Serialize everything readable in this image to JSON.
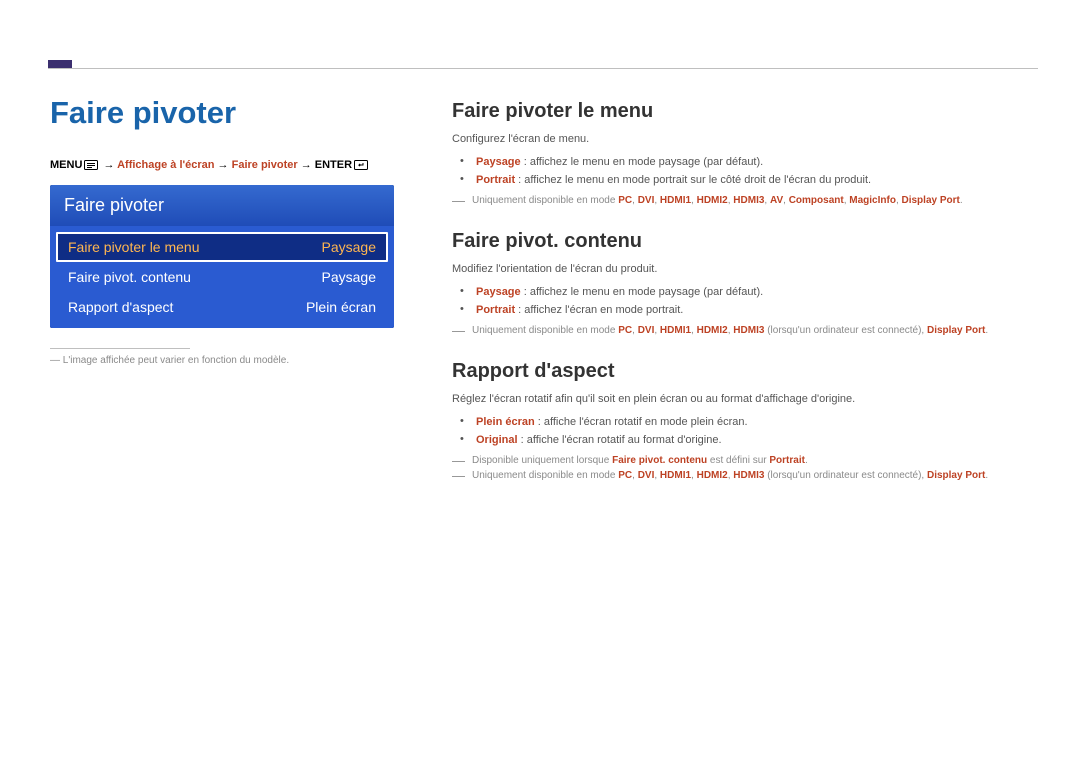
{
  "main_title": "Faire pivoter",
  "breadcrumb": {
    "menu": "MENU",
    "arrow": "→",
    "p1": "Affichage à l'écran",
    "p2": "Faire pivoter",
    "enter": "ENTER"
  },
  "osd": {
    "title": "Faire pivoter",
    "rows": [
      {
        "label": "Faire pivoter le menu",
        "value": "Paysage",
        "selected": true
      },
      {
        "label": "Faire pivot. contenu",
        "value": "Paysage",
        "selected": false
      },
      {
        "label": "Rapport d'aspect",
        "value": "Plein écran",
        "selected": false
      }
    ]
  },
  "left_footnote": "L'image affichée peut varier en fonction du modèle.",
  "sections": [
    {
      "title": "Faire pivoter le menu",
      "intro": "Configurez l'écran de menu.",
      "bullets": [
        {
          "strong": "Paysage",
          "rest": " : affichez le menu en mode paysage (par défaut)."
        },
        {
          "strong": "Portrait",
          "rest": " : affichez le menu en mode portrait sur le côté droit de l'écran du produit."
        }
      ],
      "notes": [
        {
          "pre": "Uniquement disponible en mode ",
          "modes": [
            "PC",
            "DVI",
            "HDMI1",
            "HDMI2",
            "HDMI3",
            "AV",
            "Composant",
            "MagicInfo",
            "Display Port"
          ],
          "post": "."
        }
      ]
    },
    {
      "title": "Faire pivot. contenu",
      "intro": "Modifiez l'orientation de l'écran du produit.",
      "bullets": [
        {
          "strong": "Paysage",
          "rest": " : affichez le menu en mode paysage (par défaut)."
        },
        {
          "strong": "Portrait",
          "rest": " : affichez l'écran en mode portrait."
        }
      ],
      "notes": [
        {
          "pre": "Uniquement disponible en mode ",
          "modes": [
            "PC",
            "DVI",
            "HDMI1",
            "HDMI2",
            "HDMI3"
          ],
          "mid": " (lorsqu'un ordinateur est connecté), ",
          "midmode": "Display Port",
          "post": "."
        }
      ]
    },
    {
      "title": "Rapport d'aspect",
      "intro": "Réglez l'écran rotatif afin qu'il soit en plein écran ou au format d'affichage d'origine.",
      "bullets": [
        {
          "strong": "Plein écran",
          "rest": " : affiche l'écran rotatif en mode plein écran."
        },
        {
          "strong": "Original",
          "rest": " : affiche l'écran rotatif au format d'origine."
        }
      ],
      "notes": [
        {
          "pre": "Disponible uniquement lorsque ",
          "m1": "Faire pivot. contenu",
          "mid1": " est défini sur ",
          "m2": "Portrait",
          "post": "."
        },
        {
          "pre": "Uniquement disponible en mode ",
          "modes": [
            "PC",
            "DVI",
            "HDMI1",
            "HDMI2",
            "HDMI3"
          ],
          "mid": " (lorsqu'un ordinateur est connecté), ",
          "midmode": "Display Port",
          "post": "."
        }
      ]
    }
  ]
}
